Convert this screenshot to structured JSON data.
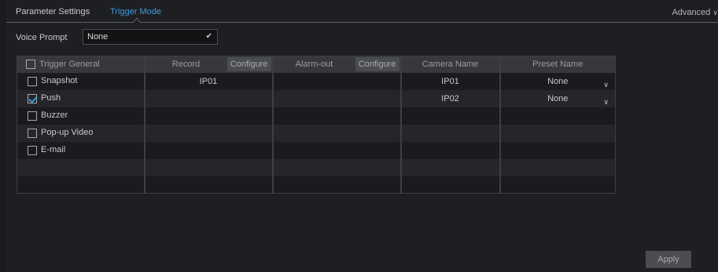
{
  "tabs": {
    "parameter_settings": "Parameter Settings",
    "trigger_mode": "Trigger Mode"
  },
  "advanced": {
    "label": "Advanced"
  },
  "voice_prompt": {
    "label": "Voice Prompt",
    "value": "None"
  },
  "table": {
    "headers": {
      "trigger_general": "Trigger General",
      "record": "Record",
      "record_configure": "Configure",
      "alarm_out": "Alarm-out",
      "alarm_configure": "Configure",
      "camera_name": "Camera Name",
      "preset_name": "Preset Name"
    },
    "rows": [
      {
        "trigger": "Snapshot",
        "checked": false,
        "record": "IP01",
        "alarm_out": "",
        "camera": "IP01",
        "preset": "None"
      },
      {
        "trigger": "Push",
        "checked": true,
        "record": "",
        "alarm_out": "",
        "camera": "IP02",
        "preset": "None"
      },
      {
        "trigger": "Buzzer",
        "checked": false,
        "record": "",
        "alarm_out": "",
        "camera": "",
        "preset": ""
      },
      {
        "trigger": "Pop-up Video",
        "checked": false,
        "record": "",
        "alarm_out": "",
        "camera": "",
        "preset": ""
      },
      {
        "trigger": "E-mail",
        "checked": false,
        "record": "",
        "alarm_out": "",
        "camera": "",
        "preset": ""
      },
      {
        "trigger": "",
        "checked": null,
        "record": "",
        "alarm_out": "",
        "camera": "",
        "preset": ""
      },
      {
        "trigger": "",
        "checked": null,
        "record": "",
        "alarm_out": "",
        "camera": "",
        "preset": ""
      }
    ]
  },
  "apply": {
    "label": "Apply"
  },
  "colors": {
    "accent": "#3d9bde",
    "background": "#1e1f22",
    "header": "#36383c"
  }
}
